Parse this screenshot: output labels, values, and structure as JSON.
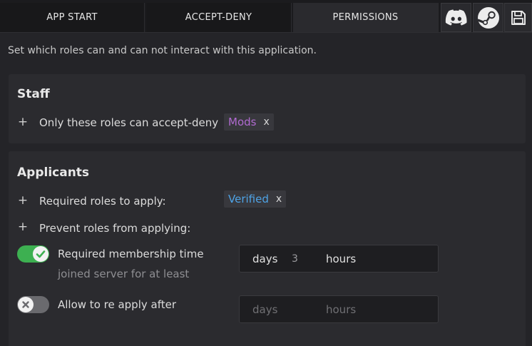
{
  "tabs": [
    {
      "label": "APP START"
    },
    {
      "label": "ACCEPT-DENY"
    },
    {
      "label": "PERMISSIONS"
    }
  ],
  "icons": {
    "discord": "discord-icon",
    "steam": "steam-icon",
    "save": "save-icon"
  },
  "description": "Set which roles can and can not interact with this application.",
  "staff": {
    "title": "Staff",
    "accept_deny_label": "Only these roles can accept-deny",
    "roles": [
      {
        "name": "Mods",
        "color": "#b06ad0",
        "remove": "x"
      }
    ]
  },
  "applicants": {
    "title": "Applicants",
    "required_label": "Required roles to apply:",
    "required_roles": [
      {
        "name": "Verified",
        "color": "#4ea3e6",
        "remove": "x"
      }
    ],
    "prevent_label": "Prevent roles from applying:",
    "membership": {
      "label": "Required membership time",
      "sublabel": "joined server for at least",
      "enabled": true,
      "days_label": "days",
      "days_value": "3",
      "hours_label": "hours"
    },
    "reapply": {
      "label": "Allow to re apply after",
      "enabled": false,
      "days_label": "days",
      "hours_label": "hours"
    }
  },
  "colors": {
    "accent_green": "#3db051",
    "background": "#242428",
    "panel": "#2b2b2f"
  }
}
